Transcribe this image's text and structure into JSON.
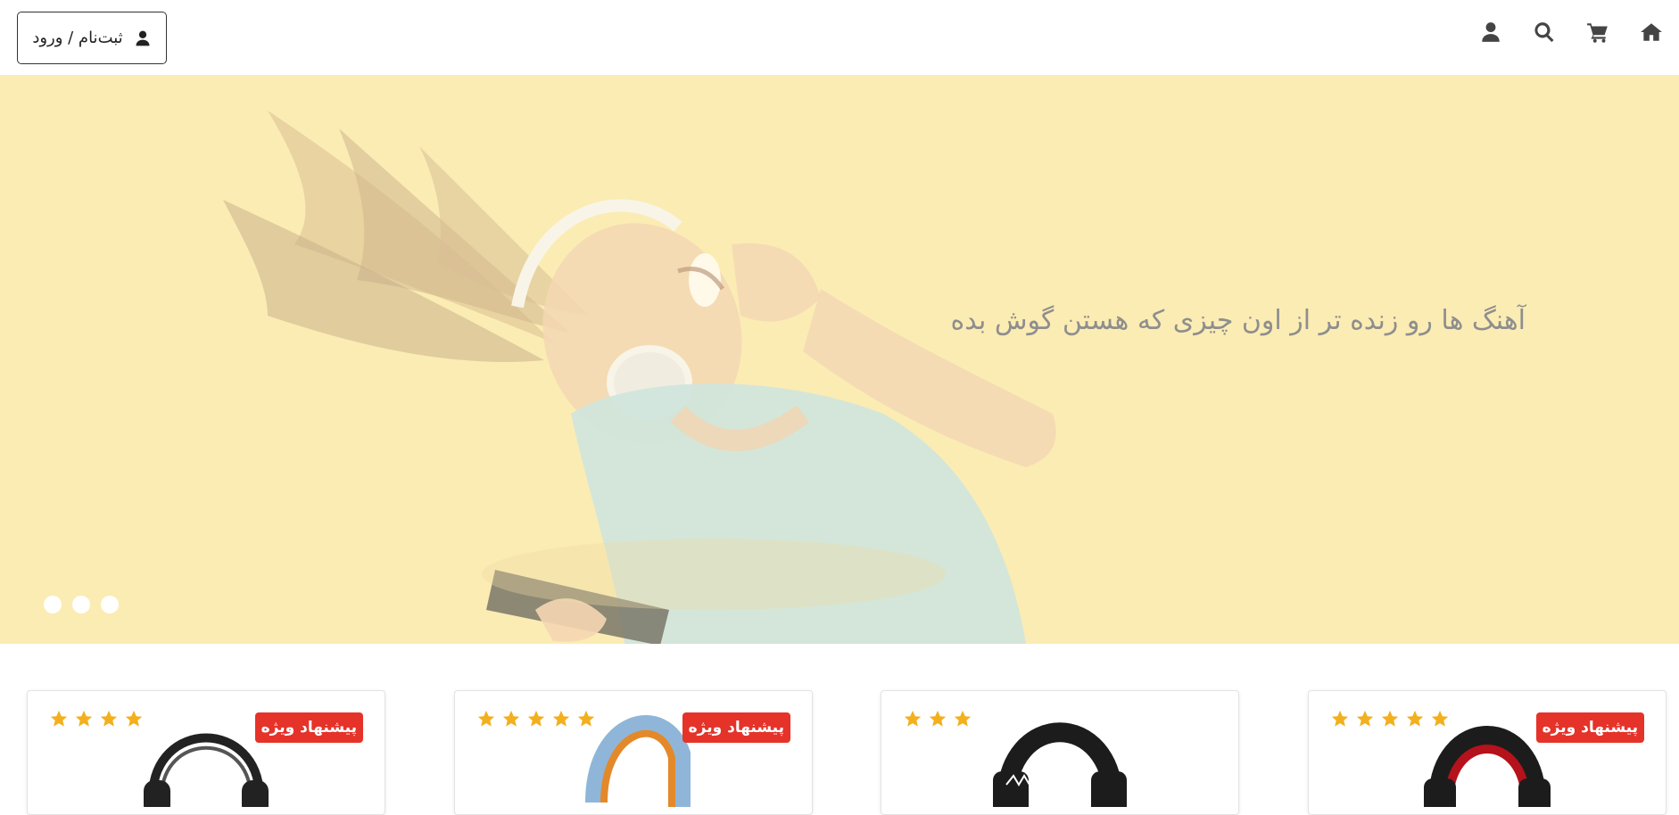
{
  "header": {
    "nav_icons": [
      "home-icon",
      "cart-icon",
      "search-icon",
      "user-icon"
    ],
    "login_label": "ثبت‌نام / ورود"
  },
  "hero": {
    "headline": "آهنگ ها رو زنده تر از اون چیزی که هستن گوش بده",
    "slide_dots": 3,
    "background_color": "#f9e7a4"
  },
  "products": [
    {
      "rating": 4,
      "badge": "پیشنهاد ویژه",
      "headphone_color": "#222222"
    },
    {
      "rating": 5,
      "badge": "پیشنهاد ویژه",
      "headphone_color": "#8fb6d8"
    },
    {
      "rating": 3,
      "badge": "",
      "headphone_color": "#1c1c1c"
    },
    {
      "rating": 5,
      "badge": "پیشنهاد ویژه",
      "headphone_color": "#b5121b"
    }
  ],
  "colors": {
    "accent_badge": "#e5332a",
    "star": "#f2b01e"
  }
}
